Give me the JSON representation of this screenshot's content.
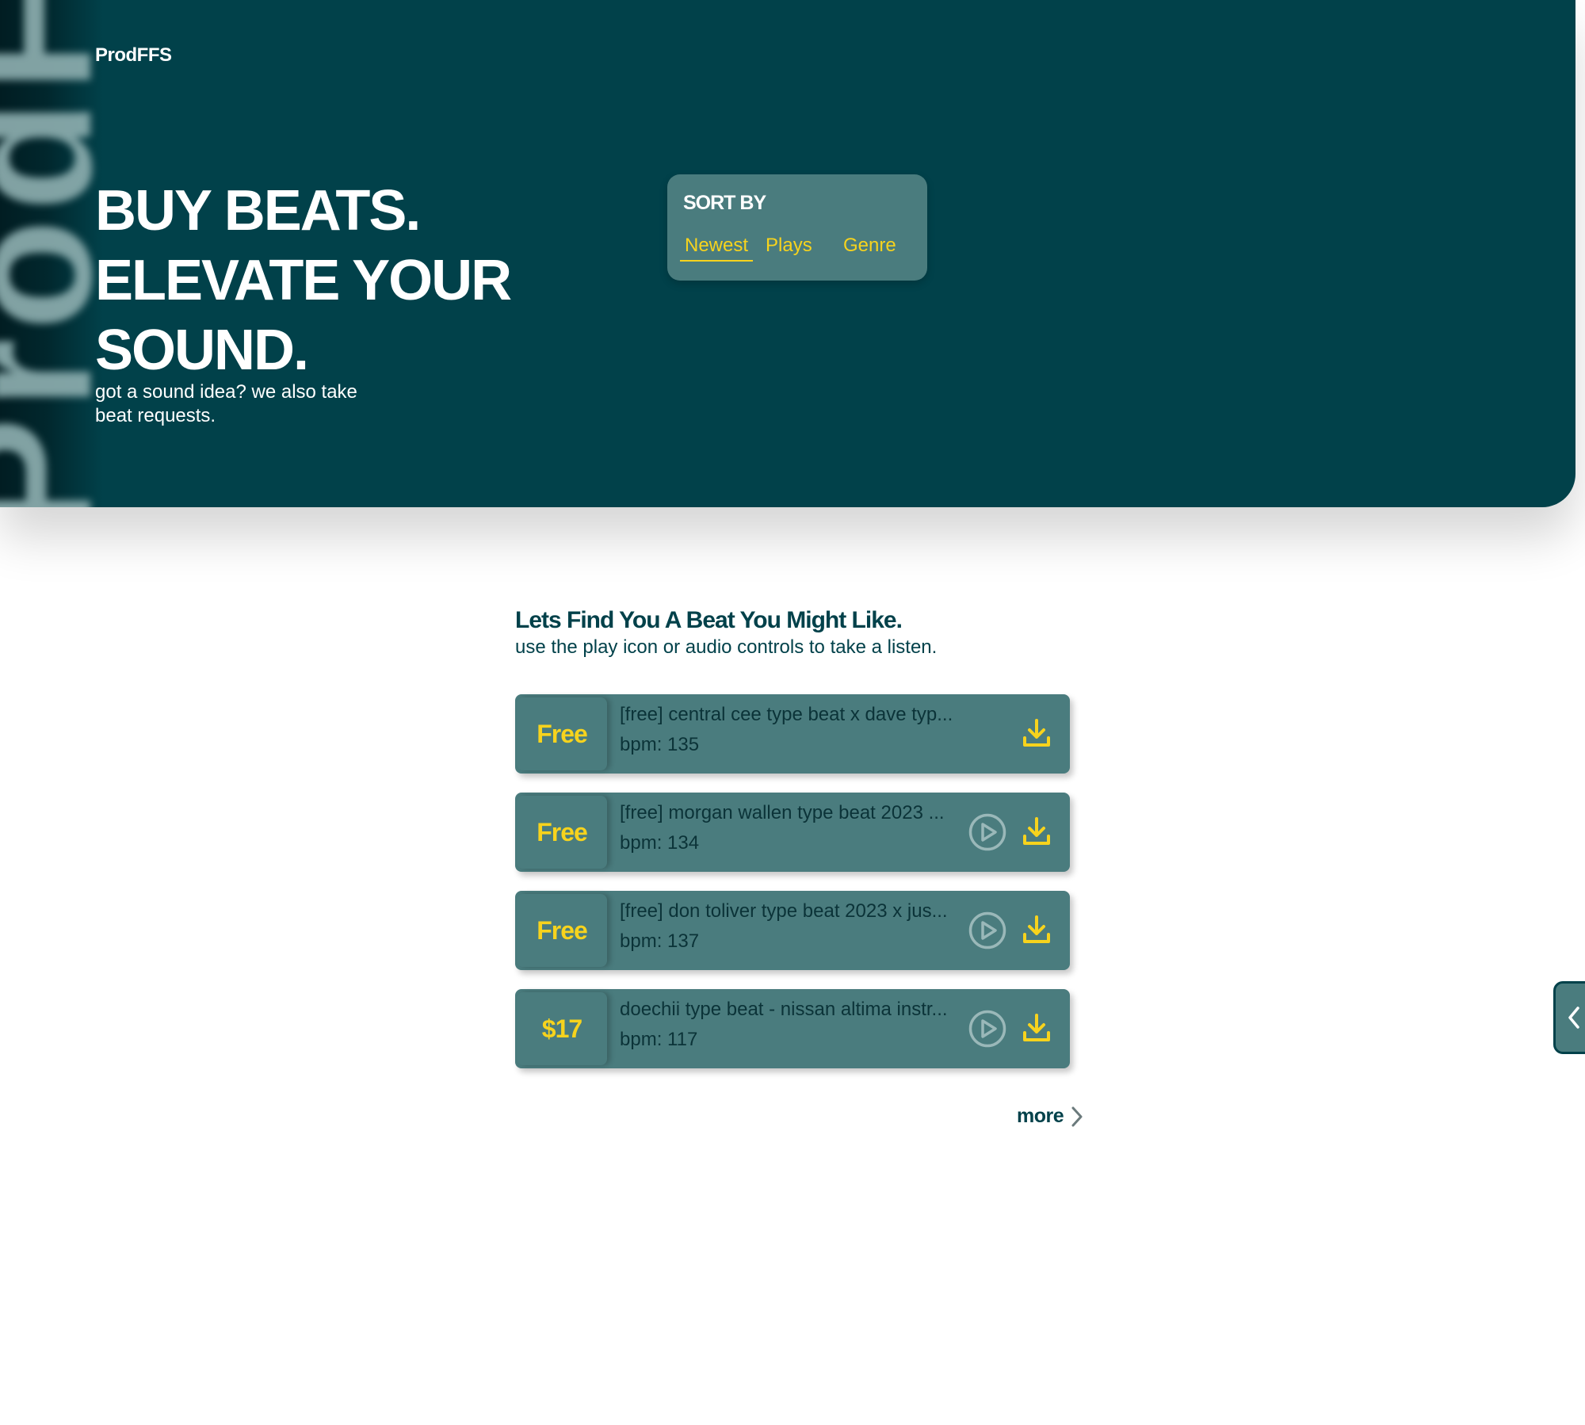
{
  "brand": {
    "logo": "ProdFFS",
    "side_word": "ProdFFS"
  },
  "hero": {
    "headline_lines": [
      "BUY BEATS.",
      "ELEVATE YOUR",
      "SOUND."
    ],
    "tagline": "got a sound idea? we also take beat requests."
  },
  "sort": {
    "title": "SORT BY",
    "options": [
      "Newest",
      "Plays",
      "Genre"
    ],
    "selected": "Newest"
  },
  "section": {
    "title": "Lets Find You A Beat You Might Like.",
    "subtitle": "use the play icon or audio controls to take a listen."
  },
  "beats": [
    {
      "price": "Free",
      "title": "[free] central cee type beat x dave typ...",
      "bpm": "bpm: 135",
      "has_play": false
    },
    {
      "price": "Free",
      "title": "[free] morgan wallen type beat 2023 ...",
      "bpm": "bpm: 134",
      "has_play": true
    },
    {
      "price": "Free",
      "title": "[free] don toliver type beat 2023 x jus...",
      "bpm": "bpm: 137",
      "has_play": true
    },
    {
      "price": "$17",
      "title": "doechii type beat - nissan altima instr...",
      "bpm": "bpm: 117",
      "has_play": true
    }
  ],
  "more": {
    "label": "more"
  },
  "icons": {
    "play": "play-circle-icon",
    "download": "download-icon",
    "more_arrow": "chevron-right-icon",
    "side_tab": "chevron-left-icon"
  },
  "colors": {
    "hero_bg": "#01414a",
    "card_bg": "#4a7c7e",
    "accent": "#f7d31d",
    "text_dark": "#01414a",
    "white": "#ffffff"
  }
}
